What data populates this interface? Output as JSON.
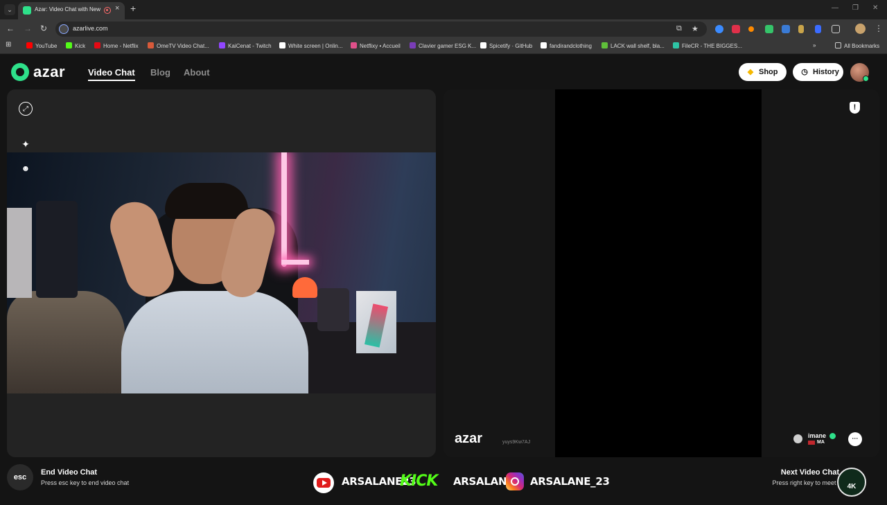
{
  "browser": {
    "tab_title": "Azar: Video Chat with New",
    "url": "azarlive.com",
    "bookmarks": [
      {
        "label": "YouTube",
        "color": "#ff0000"
      },
      {
        "label": "Kick",
        "color": "#53fc18"
      },
      {
        "label": "Home - Netflix",
        "color": "#e50914"
      },
      {
        "label": "OmeTV Video Chat...",
        "color": "#d85a3a"
      },
      {
        "label": "KaiCenat - Twitch",
        "color": "#9146ff"
      },
      {
        "label": "White screen | Onlin...",
        "color": "#ffffff"
      },
      {
        "label": "Netflixy • Accueil",
        "color": "#e0508a"
      },
      {
        "label": "Clavier gamer ESG K...",
        "color": "#7a3db8"
      },
      {
        "label": "Spicetify · GitHub",
        "color": "#ffffff"
      },
      {
        "label": "fandirandclothing",
        "color": "#ffffff"
      },
      {
        "label": "LACK wall shelf, bla...",
        "color": "#5fbf3a"
      },
      {
        "label": "FileCR - THE BIGGES...",
        "color": "#2ec4a5"
      }
    ],
    "all_bookmarks": "All Bookmarks"
  },
  "header": {
    "logo": "azar",
    "nav": [
      "Video Chat",
      "Blog",
      "About"
    ],
    "shop": "Shop",
    "history": "History"
  },
  "remote": {
    "watermark": "azar",
    "watermark_id": "yuys9Kw7AJ",
    "user_name": "imane",
    "country": "MA"
  },
  "footer": {
    "esc_key": "esc",
    "end_title": "End Video Chat",
    "end_sub": "Press esc key to end video chat",
    "next_title": "Next Video Chat",
    "next_sub": "Press right key to meet others"
  },
  "overlay": {
    "youtube_handle": "ARSALANE23",
    "kick_logo": "KICK",
    "kick_handle": "ARSALANE1",
    "instagram_handle": "ARSALANE_23",
    "badge": "4K"
  },
  "colors": {
    "brand": "#2ee08a",
    "page_bg": "#141414",
    "panel_bg": "#232323"
  }
}
